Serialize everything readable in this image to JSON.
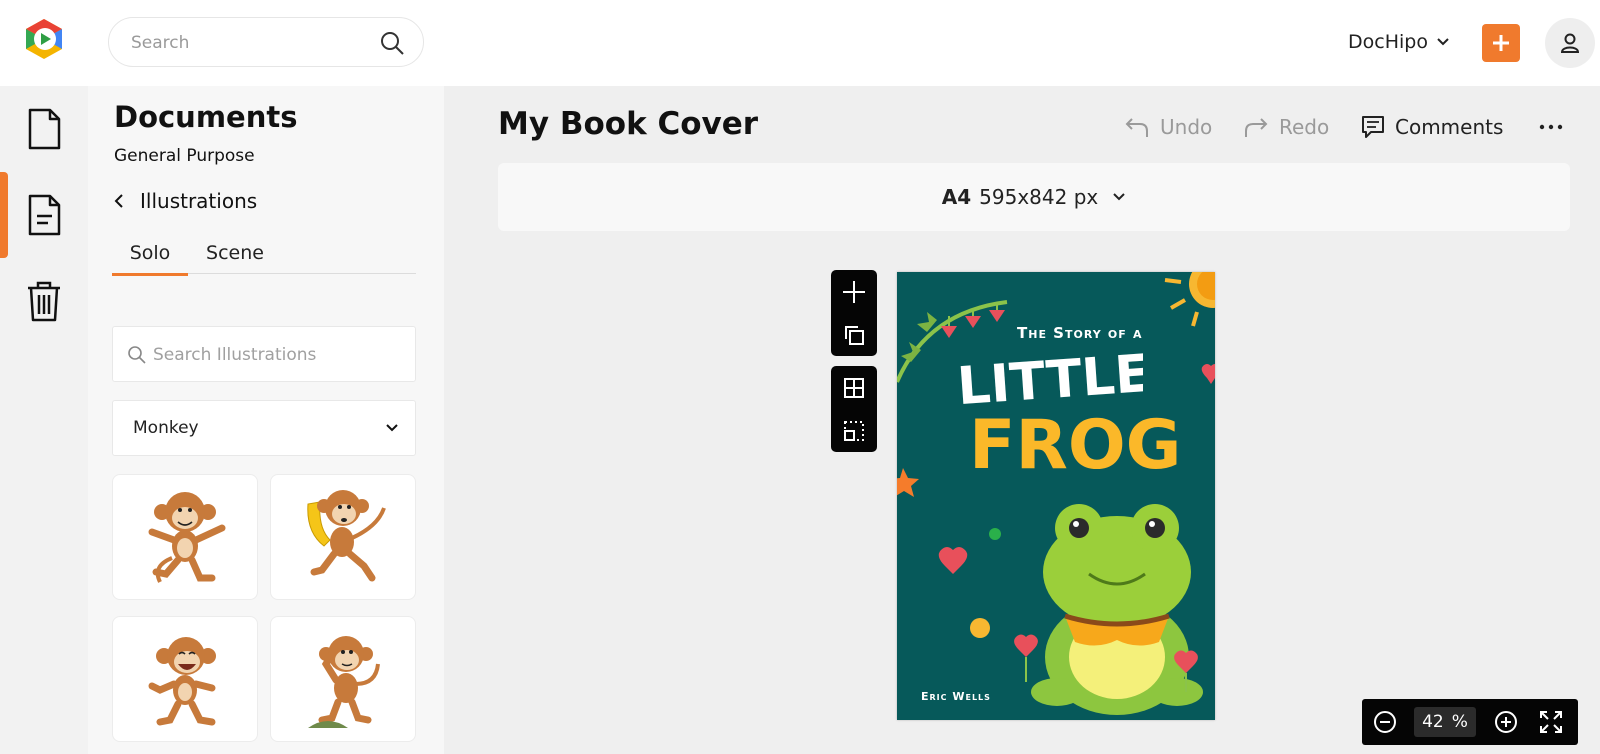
{
  "brand": {
    "logo_icon": "dochipo-logo-icon",
    "accent": "#f07a2d"
  },
  "search": {
    "placeholder": "Search",
    "value": ""
  },
  "account": {
    "name": "DocHipo"
  },
  "sidebar": {
    "items": [
      {
        "name": "document-icon",
        "active": false
      },
      {
        "name": "documents-list-icon",
        "active": true
      },
      {
        "name": "trash-icon",
        "active": false
      }
    ]
  },
  "panel": {
    "title": "Documents",
    "subtitle": "General Purpose",
    "breadcrumb": "Illustrations",
    "tabs": [
      {
        "label": "Solo",
        "active": true
      },
      {
        "label": "Scene",
        "active": false
      }
    ],
    "search_placeholder": "Search Illustrations",
    "category": "Monkey",
    "thumbnails": [
      "monkey-pointing",
      "monkey-banana",
      "monkey-laughing",
      "monkey-thinking"
    ]
  },
  "editor": {
    "title": "My Book Cover",
    "undo": "Undo",
    "redo": "Redo",
    "comments": "Comments",
    "size_name": "A4",
    "size_dims": "595x842 px"
  },
  "cover": {
    "line1": "The Story of a",
    "line2": "LITTLE",
    "line3": "FROG",
    "author": "Eric Wells",
    "bg_color": "#06595a"
  },
  "zoom": {
    "value": "42",
    "unit": "%"
  }
}
